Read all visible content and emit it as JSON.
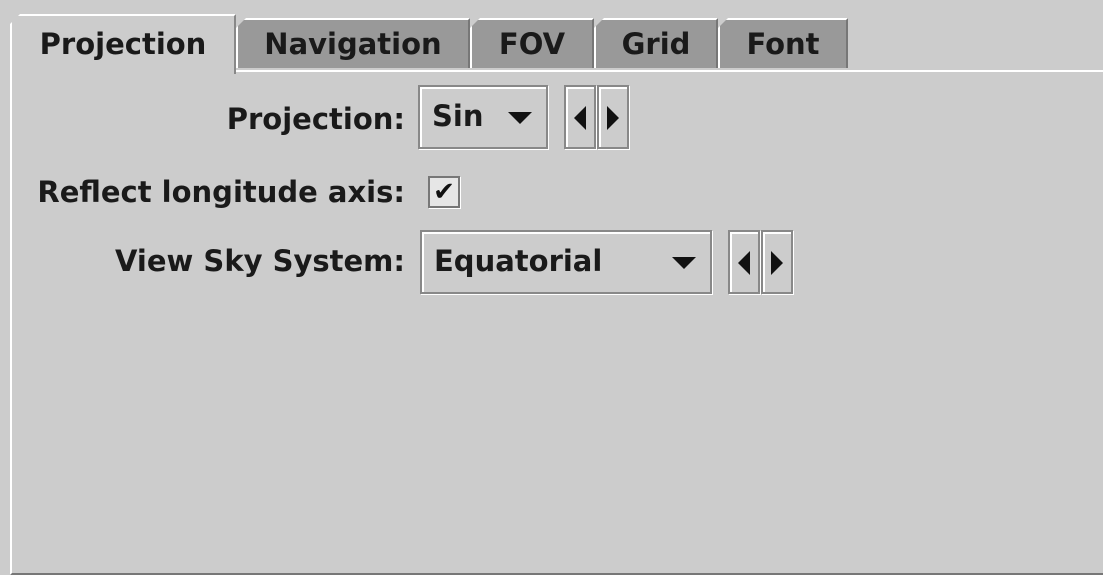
{
  "tabs": [
    {
      "label": "Projection",
      "active": true
    },
    {
      "label": "Navigation",
      "active": false
    },
    {
      "label": "FOV",
      "active": false
    },
    {
      "label": "Grid",
      "active": false
    },
    {
      "label": "Font",
      "active": false
    }
  ],
  "projection": {
    "label": "Projection:",
    "value": "Sin",
    "prev_icon": "triangle-left-icon",
    "next_icon": "triangle-right-icon"
  },
  "reflect": {
    "label": "Reflect longitude axis:",
    "checked": true,
    "check_glyph": "✔"
  },
  "sky_system": {
    "label": "View Sky System:",
    "value": "Equatorial",
    "prev_icon": "triangle-left-icon",
    "next_icon": "triangle-right-icon"
  },
  "colors": {
    "panel_background": "#cccccc",
    "inactive_tab": "#999999",
    "highlight": "#ffffff",
    "shadow": "#777777"
  }
}
